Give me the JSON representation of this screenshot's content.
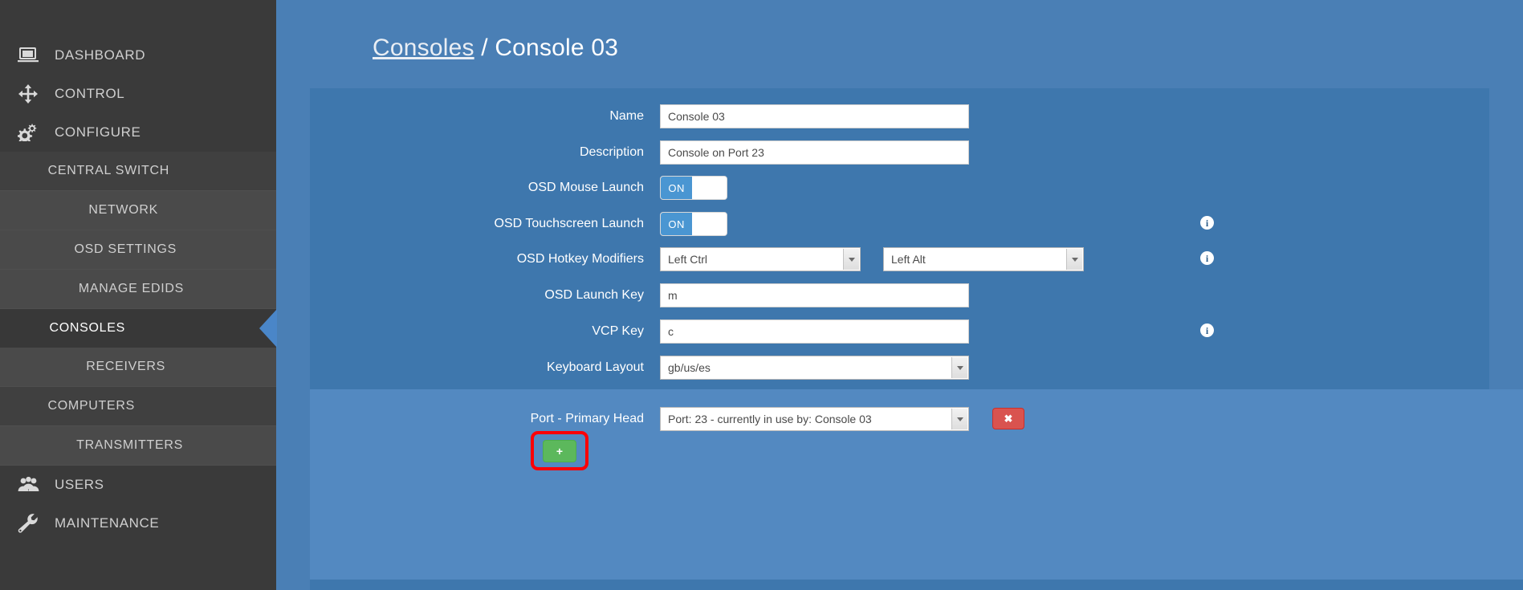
{
  "sidebar": {
    "items": [
      {
        "label": "DASHBOARD",
        "icon": "laptop-icon",
        "level": 0,
        "active": false
      },
      {
        "label": "CONTROL",
        "icon": "move-icon",
        "level": 0,
        "active": false
      },
      {
        "label": "CONFIGURE",
        "icon": "gears-icon",
        "level": 0,
        "active": false
      },
      {
        "label": "CENTRAL SWITCH",
        "icon": "",
        "level": 1,
        "active": false
      },
      {
        "label": "NETWORK",
        "icon": "",
        "level": 2,
        "active": false
      },
      {
        "label": "OSD SETTINGS",
        "icon": "",
        "level": 2,
        "active": false
      },
      {
        "label": "MANAGE EDIDS",
        "icon": "",
        "level": 2,
        "active": false
      },
      {
        "label": "CONSOLES",
        "icon": "",
        "level": 1,
        "active": true
      },
      {
        "label": "RECEIVERS",
        "icon": "",
        "level": 2,
        "active": false
      },
      {
        "label": "COMPUTERS",
        "icon": "",
        "level": 1,
        "active": false
      },
      {
        "label": "TRANSMITTERS",
        "icon": "",
        "level": 2,
        "active": false
      },
      {
        "label": "USERS",
        "icon": "users-icon",
        "level": 0,
        "active": false
      },
      {
        "label": "MAINTENANCE",
        "icon": "wrench-icon",
        "level": 0,
        "active": false
      }
    ]
  },
  "breadcrumb": {
    "parent": "Consoles",
    "separator": "/",
    "current": "Console 03"
  },
  "form": {
    "name": {
      "label": "Name",
      "value": "Console 03",
      "placeholder": ""
    },
    "description": {
      "label": "Description",
      "value": "Console on Port 23",
      "placeholder": ""
    },
    "osd_mouse_launch": {
      "label": "OSD Mouse Launch",
      "state": "ON"
    },
    "osd_touchscreen_launch": {
      "label": "OSD Touchscreen Launch",
      "state": "ON",
      "info": "i"
    },
    "osd_hotkey_modifiers": {
      "label": "OSD Hotkey Modifiers",
      "modifier1": "Left Ctrl",
      "modifier2": "Left Alt",
      "info": "i"
    },
    "osd_launch_key": {
      "label": "OSD Launch Key",
      "value": "m",
      "placeholder": ""
    },
    "vcp_key": {
      "label": "VCP Key",
      "value": "c",
      "placeholder": "",
      "info": "i"
    },
    "keyboard_layout": {
      "label": "Keyboard Layout",
      "value": "gb/us/es"
    }
  },
  "ports": {
    "primary_head": {
      "label": "Port - Primary Head",
      "value": "Port: 23 - currently in use by: Console 03",
      "remove_label": "✖"
    },
    "add_label": "+"
  },
  "colors": {
    "sidebar_bg": "#3a3a3a",
    "page_bg": "#4a7fb5",
    "panel_dark": "#3e77ad",
    "panel_light": "#5389c1",
    "accent_blue": "#4a86c8",
    "toggle_on": "#4a96d2",
    "danger": "#d9534f",
    "success": "#5cb85c",
    "highlight": "#fb0007"
  }
}
